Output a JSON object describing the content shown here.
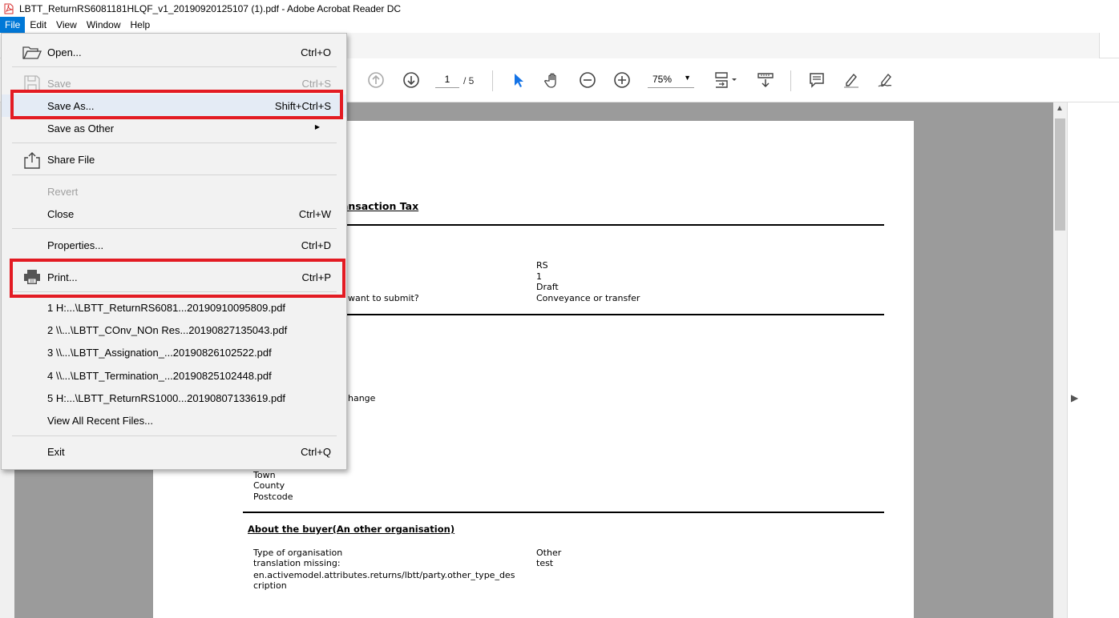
{
  "window": {
    "title": "LBTT_ReturnRS6081181HLQF_v1_20190920125107 (1).pdf - Adobe Acrobat Reader DC"
  },
  "menubar": {
    "items": [
      "File",
      "Edit",
      "View",
      "Window",
      "Help"
    ]
  },
  "toolbar": {
    "page_current": "1",
    "page_total": "/ 5",
    "zoom": "75%"
  },
  "file_menu": {
    "open": {
      "label": "Open...",
      "shortcut": "Ctrl+O"
    },
    "save": {
      "label": "Save",
      "shortcut": "Ctrl+S"
    },
    "save_as": {
      "label": "Save As...",
      "shortcut": "Shift+Ctrl+S"
    },
    "save_as_other": {
      "label": "Save as Other"
    },
    "share_file": {
      "label": "Share File"
    },
    "revert": {
      "label": "Revert"
    },
    "close": {
      "label": "Close",
      "shortcut": "Ctrl+W"
    },
    "properties": {
      "label": "Properties...",
      "shortcut": "Ctrl+D"
    },
    "print": {
      "label": "Print...",
      "shortcut": "Ctrl+P"
    },
    "recent": [
      "1 H:...\\LBTT_ReturnRS6081...20190910095809.pdf",
      "2 \\\\...\\LBTT_COnv_NOn Res...20190827135043.pdf",
      "3 \\\\...\\LBTT_Assignation_...20190826102522.pdf",
      "4 \\\\...\\LBTT_Termination_...20190825102448.pdf",
      "5 H:...\\LBTT_ReturnRS1000...20190807133619.pdf"
    ],
    "view_all_recent": {
      "label": "View All Recent Files..."
    },
    "exit": {
      "label": "Exit",
      "shortcut": "Ctrl+Q"
    }
  },
  "document": {
    "title_fragment": "ansaction Tax",
    "summary_values": [
      "RS",
      "1",
      "Draft",
      "Conveyance or transfer"
    ],
    "summary_question_fragment": "want to submit?",
    "fragment_change": "hange",
    "address_labels": [
      "Town",
      "County",
      "Postcode"
    ],
    "buyer_section_title": "About the buyer(An other organisation)",
    "buyer_labels": [
      "Type of organisation",
      "translation missing:",
      "en.activemodel.attributes.returns/lbtt/party.other_type_des",
      "cription"
    ],
    "buyer_values": [
      "Other",
      "test"
    ]
  }
}
